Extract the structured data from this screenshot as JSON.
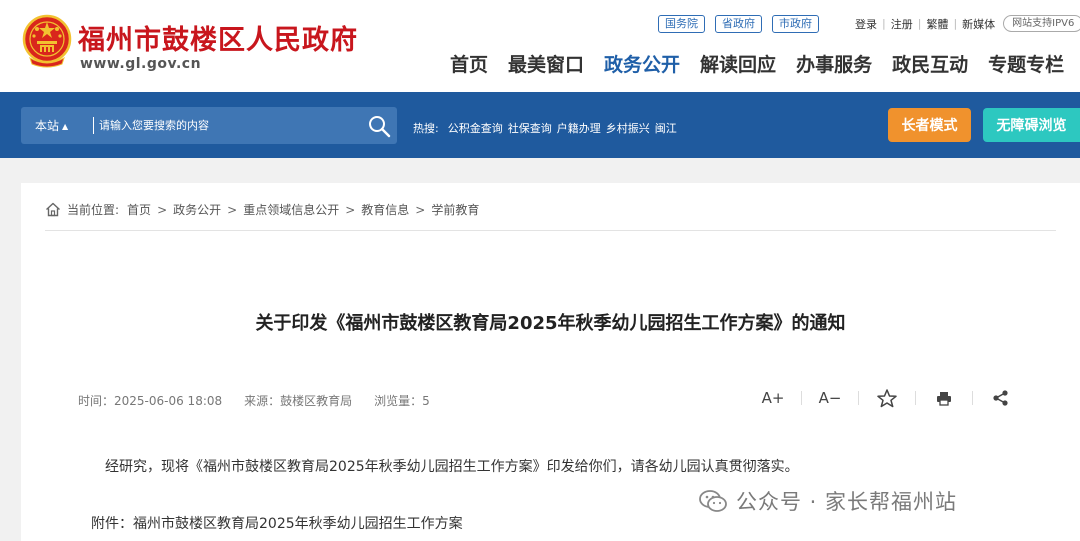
{
  "header": {
    "site_title": "福州市鼓楼区人民政府",
    "site_url": "www.gl.gov.cn",
    "gov_links": [
      "国务院",
      "省政府",
      "市政府"
    ],
    "user_links": [
      "登录",
      "注册",
      "繁體",
      "新媒体"
    ],
    "ipv6_badge": "网站支持IPV6",
    "nav": [
      {
        "label": "首页",
        "active": false
      },
      {
        "label": "最美窗口",
        "active": false
      },
      {
        "label": "政务公开",
        "active": true
      },
      {
        "label": "解读回应",
        "active": false
      },
      {
        "label": "办事服务",
        "active": false
      },
      {
        "label": "政民互动",
        "active": false
      },
      {
        "label": "专题专栏",
        "active": false
      }
    ]
  },
  "search": {
    "scope": "本站",
    "placeholder": "请输入您要搜索的内容",
    "hot_label": "热搜:",
    "hot_items": [
      "公积金查询",
      "社保查询",
      "户籍办理",
      "乡村振兴",
      "闽江"
    ]
  },
  "buttons": {
    "elder_mode": "长者模式",
    "accessibility": "无障碍浏览"
  },
  "breadcrumb": {
    "label": "当前位置:",
    "items": [
      "首页",
      "政务公开",
      "重点领域信息公开",
      "教育信息",
      "学前教育"
    ]
  },
  "article": {
    "title": "关于印发《福州市鼓楼区教育局2025年秋季幼儿园招生工作方案》的通知",
    "time": "时间：2025-06-06 18:08",
    "source": "来源：鼓楼区教育局",
    "views": "浏览量：5",
    "tools": {
      "font_larger": "A+",
      "font_smaller": "A−"
    },
    "paragraph": "经研究，现将《福州市鼓楼区教育局2025年秋季幼儿园招生工作方案》印发给你们，请各幼儿园认真贯彻落实。",
    "attachment": "附件：福州市鼓楼区教育局2025年秋季幼儿园招生工作方案"
  },
  "watermark": "公众号 · 家长帮福州站",
  "colors": {
    "brand_red": "#c8161d",
    "nav_blue": "#1f5fa8",
    "band_blue": "#1f5a9e",
    "elder_orange": "#f0922d",
    "access_teal": "#2dc8c0"
  }
}
